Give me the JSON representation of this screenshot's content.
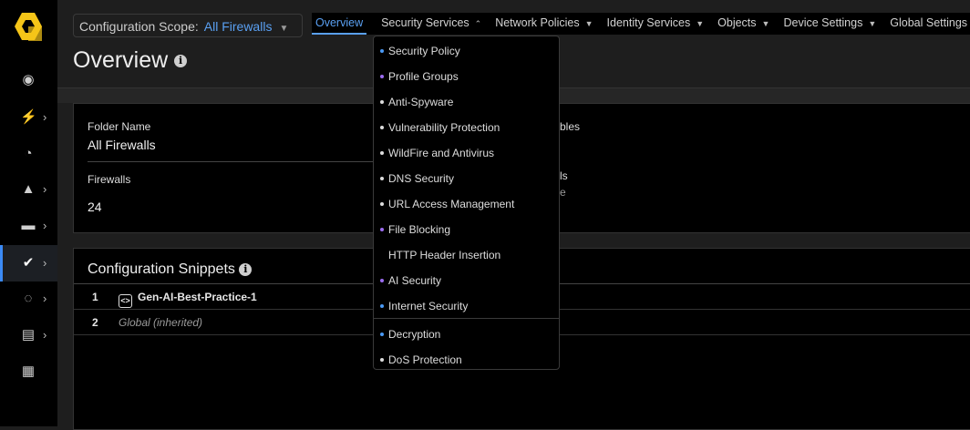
{
  "header": {
    "scope_label": "Configuration Scope:",
    "scope_value": "All Firewalls",
    "title": "Overview"
  },
  "topnav": [
    {
      "label": "Overview",
      "active": true
    },
    {
      "label": "Security Services",
      "open": true
    },
    {
      "label": "Network Policies"
    },
    {
      "label": "Identity Services"
    },
    {
      "label": "Objects"
    },
    {
      "label": "Device Settings"
    },
    {
      "label": "Global Settings"
    }
  ],
  "sidebar": [
    "monitor",
    "insights",
    "dashboards",
    "incidents",
    "activity",
    "manage",
    "workflows",
    "reports",
    "marketplace"
  ],
  "summary": {
    "folder_label": "Folder Name",
    "folder_value": "All Firewalls",
    "firewalls_label": "Firewalls",
    "firewalls_value": "24",
    "frag1": "bles",
    "frag2": "ls",
    "frag3": "e"
  },
  "snippets": {
    "title": "Configuration Snippets",
    "rows": [
      {
        "num": "1",
        "name": "Gen-AI-Best-Practice-1"
      },
      {
        "num": "2",
        "name": "Global (inherited)"
      }
    ]
  },
  "menu": {
    "items": [
      {
        "label": "Security Policy",
        "dot": "#4a9af5"
      },
      {
        "label": "Profile Groups",
        "dot": "#9b6cf0"
      },
      {
        "label": "Anti-Spyware",
        "dot": "#dddddd"
      },
      {
        "label": "Vulnerability Protection",
        "dot": "#dddddd"
      },
      {
        "label": "WildFire and Antivirus",
        "dot": "#dddddd"
      },
      {
        "label": "DNS Security",
        "dot": "#dddddd"
      },
      {
        "label": "URL Access Management",
        "dot": "#dddddd"
      },
      {
        "label": "File Blocking",
        "dot": "#9b6cf0"
      },
      {
        "label": "HTTP Header Insertion",
        "dot": ""
      },
      {
        "label": "AI Security",
        "dot": "#9b6cf0"
      },
      {
        "label": "Internet Security",
        "dot": "#4a9af5"
      },
      {
        "label": "Decryption",
        "dot": "#4a9af5"
      },
      {
        "label": "DoS Protection",
        "dot": "#dddddd"
      }
    ]
  }
}
